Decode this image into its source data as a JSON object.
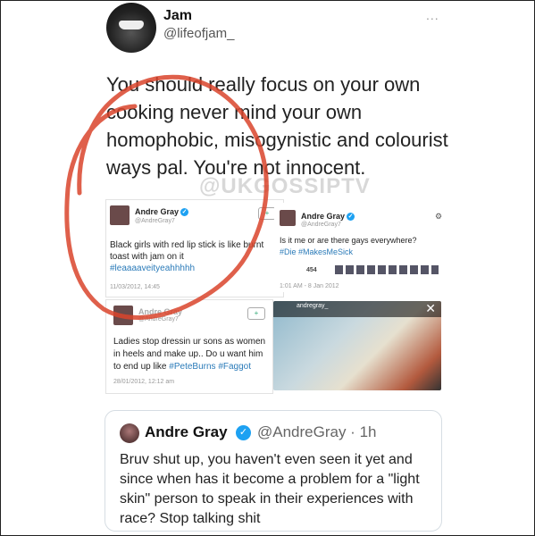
{
  "main_tweet": {
    "name": "Jam",
    "handle": "@lifeofjam_",
    "more": "...",
    "text": "You should really focus on your own cooking never mind your own homophobic, misogynistic and colourist ways pal. You're not innocent."
  },
  "watermark": "@UKGOSSIPTV",
  "screenshots": {
    "tweet1": {
      "name": "Andre Gray",
      "handle": "@AndreGray7",
      "text": "Black girls with red lip stick is like burnt toast with jam on it",
      "hashtag": "#leaaaaveityeahhhhh",
      "date": "11/03/2012, 14:45"
    },
    "tweet2": {
      "name": "Andre Gray",
      "handle": "@AndreGray7",
      "text": "Is it me or are there gays everywhere?",
      "hashtags": "#Die #MakesMeSick",
      "likes": "454",
      "date": "1:01 AM - 8 Jan 2012"
    },
    "tweet3": {
      "name": "Andre Gray",
      "handle": "@AndreGray7",
      "text": "Ladies stop dressin ur sons as women in heels and make up.. Do u want him to end up like",
      "hashtags": "#PeteBurns #Faggot",
      "date": "28/01/2012, 12:12 am"
    },
    "photo_user": "andregray_"
  },
  "quote_tweet": {
    "name": "Andre Gray",
    "handle": "@AndreGray · 1h",
    "text": "Bruv shut up, you haven't even seen it yet and since when has it become a problem for a \"light skin\" person to speak in their experiences with race? Stop talking shit"
  },
  "colors": {
    "scribble": "#d9442c",
    "link": "#2b7bb9",
    "verified": "#1da1f2"
  }
}
